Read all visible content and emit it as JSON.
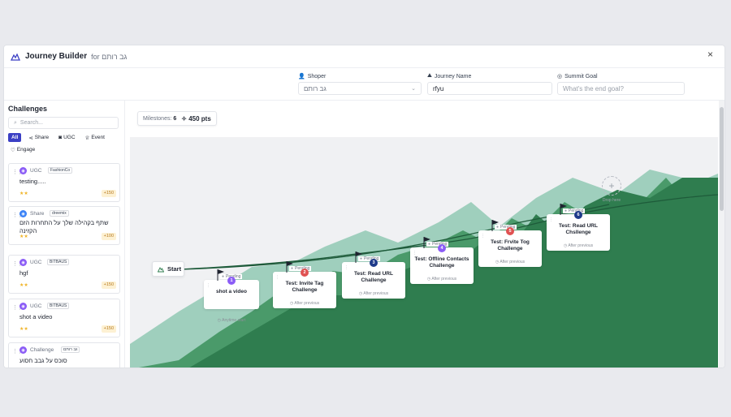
{
  "window": {
    "title": "Journey Builder",
    "for_label": "for גב רותם",
    "close": "×"
  },
  "fields": {
    "shopper": {
      "label": "Shoper",
      "value": "גב רותם"
    },
    "journey_name": {
      "label": "Journey Name",
      "value": "rfyu"
    },
    "summit_goal": {
      "label": "Summit Goal",
      "placeholder": "What's the end goal?"
    }
  },
  "sidebar": {
    "title": "Challenges",
    "search_placeholder": "Search...",
    "filters": [
      {
        "label": "All",
        "active": true
      },
      {
        "label": "Share",
        "icon": "share-icon"
      },
      {
        "label": "UGC",
        "icon": "camera-icon"
      },
      {
        "label": "Event",
        "icon": "trophy-icon"
      },
      {
        "label": "Engage",
        "icon": "heart-icon"
      }
    ],
    "cards": [
      {
        "type": "UGC",
        "brand": "FashionCo",
        "name": "testing.....",
        "stars": "★★",
        "points": "+150",
        "color": "#8b5cf6"
      },
      {
        "type": "Share",
        "brand": "dreemix",
        "name": "שתף בקהילה שלך על התחרות הזם הקזינה",
        "stars": "★★",
        "points": "+100",
        "color": "#3b82f6"
      },
      {
        "type": "UGC",
        "brand": "BITBAUS",
        "name": "hgf",
        "stars": "★★",
        "points": "+150",
        "color": "#8b5cf6"
      },
      {
        "type": "UGC",
        "brand": "BITBAUS",
        "name": "shot a video",
        "stars": "★★",
        "points": "+150",
        "color": "#8b5cf6"
      },
      {
        "type": "Challenge",
        "brand": "גב רותם",
        "name": "סוכס על גבב חסוע",
        "stars": "",
        "points": "",
        "color": "#8b5cf6"
      }
    ]
  },
  "canvas": {
    "milestones_label": "Milestones:",
    "milestones_count": "6",
    "points_total": "450 pts",
    "start_label": "Start",
    "drop_label": "Drop here",
    "milestones": [
      {
        "number": "1",
        "status": "Pending",
        "name": "shot a video",
        "sub": "Anytime start",
        "color": "#8b5cf6"
      },
      {
        "number": "2",
        "status": "Pending",
        "name": "Test: Invite Tag Challenge",
        "sub": "After previous",
        "color": "#e05252"
      },
      {
        "number": "3",
        "status": "Pending",
        "name": "Test: Read URL Challenge",
        "sub": "After previous",
        "color": "#1e3a8a"
      },
      {
        "number": "4",
        "status": "Pending",
        "name": "Test: Offline Contacts Challenge",
        "sub": "After previous",
        "color": "#8b5cf6"
      },
      {
        "number": "5",
        "status": "Pending",
        "name": "Test: Frvite Tog Challenge",
        "sub": "After previous",
        "color": "#e05252"
      },
      {
        "number": "6",
        "status": "Pending",
        "name": "Test: Read URL Chsllenge",
        "sub": "After previous",
        "color": "#1e3a8a"
      }
    ]
  },
  "colors": {
    "accent": "#3b3fc4",
    "mountain_back": "#9fcfbd",
    "mountain_front": "#2f7d4f",
    "path": "#1e5b3a"
  }
}
